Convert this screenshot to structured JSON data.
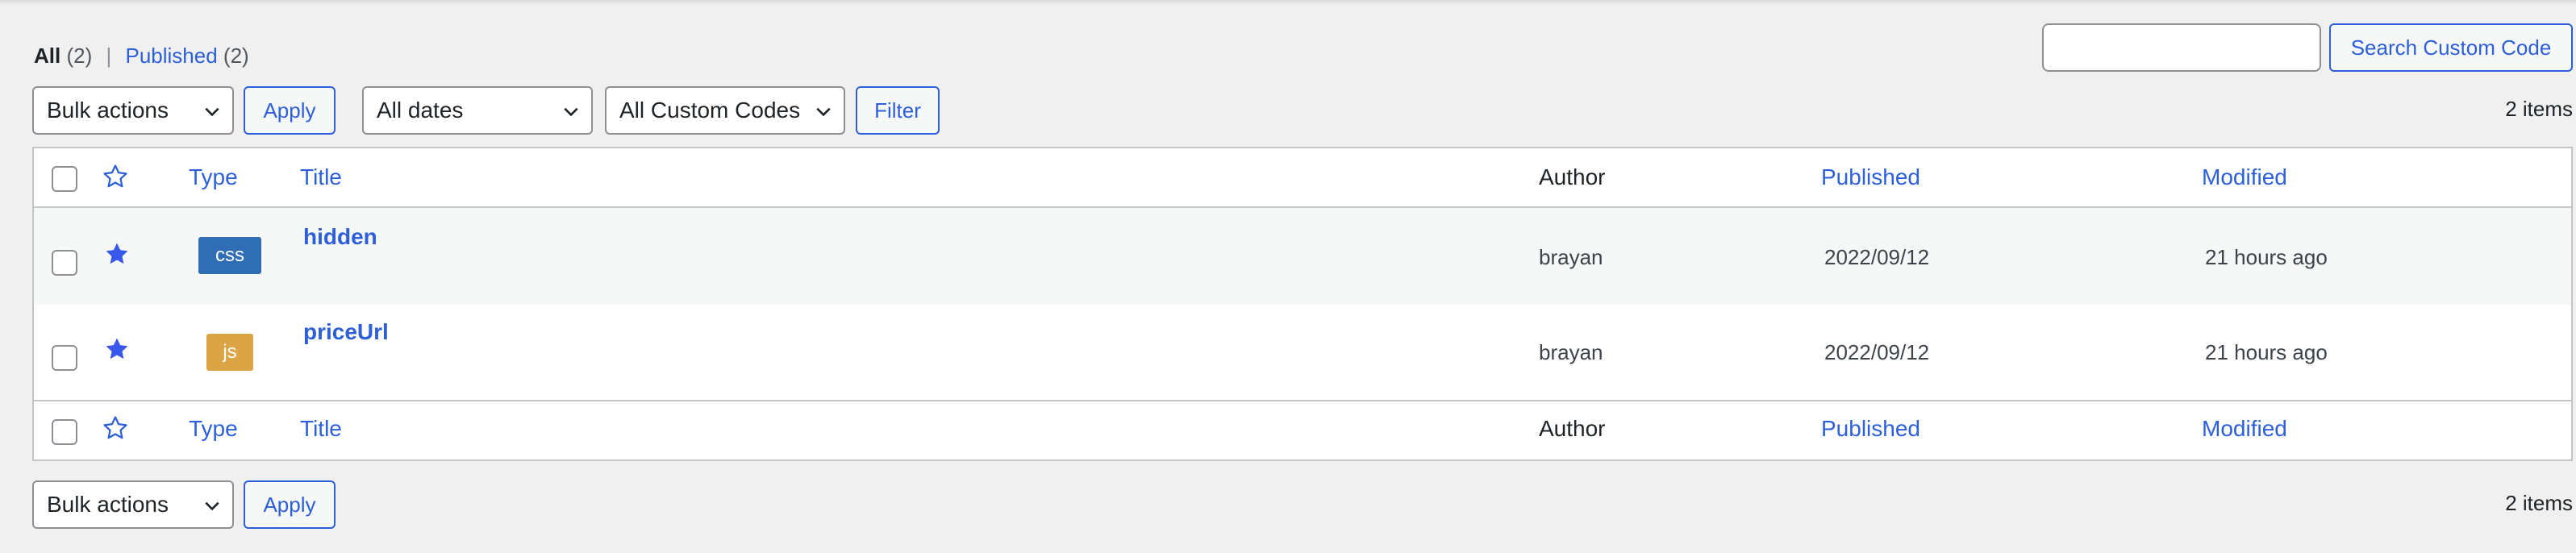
{
  "filters": {
    "all_label": "All",
    "all_count": "(2)",
    "separator": "|",
    "published_label": "Published",
    "published_count": "(2)"
  },
  "search": {
    "value": "",
    "button_label": "Search Custom Code"
  },
  "top_nav": {
    "bulk_actions": "Bulk actions",
    "apply": "Apply",
    "dates": "All dates",
    "code_types": "All Custom Codes",
    "filter": "Filter",
    "items_count": "2 items"
  },
  "columns": {
    "type": "Type",
    "title": "Title",
    "author": "Author",
    "published": "Published",
    "modified": "Modified"
  },
  "rows": [
    {
      "starred": true,
      "type": "css",
      "type_color": "#2f6db5",
      "title": "hidden",
      "author": "brayan",
      "published": "2022/09/12",
      "modified": "21 hours ago"
    },
    {
      "starred": true,
      "type": "js",
      "type_color": "#dba444",
      "title": "priceUrl",
      "author": "brayan",
      "published": "2022/09/12",
      "modified": "21 hours ago"
    }
  ],
  "bottom_nav": {
    "bulk_actions": "Bulk actions",
    "apply": "Apply",
    "items_count": "2 items"
  },
  "colors": {
    "link": "#2c5fd8",
    "star": "#3858e9",
    "background": "#f0f0f1"
  }
}
